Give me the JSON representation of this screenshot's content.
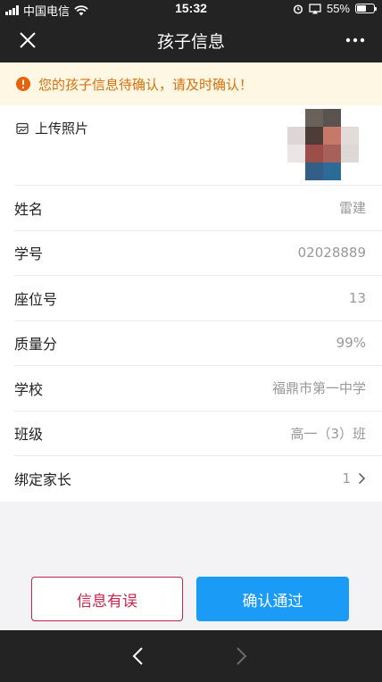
{
  "status_bar": {
    "carrier": "中国电信",
    "time": "15:32",
    "battery": "55%",
    "battery_level": 0.55
  },
  "nav": {
    "title": "孩子信息",
    "close_icon": "close-icon",
    "more_icon": "more-icon"
  },
  "notice": {
    "text": "您的孩子信息待确认，请及时确认！",
    "icon": "warning-icon",
    "color": "#d8710e"
  },
  "photo": {
    "upload_label": "上传照片",
    "icon": "image-icon"
  },
  "fields": [
    {
      "label": "姓名",
      "value": "雷建"
    },
    {
      "label": "学号",
      "value": "02028889"
    },
    {
      "label": "座位号",
      "value": "13"
    },
    {
      "label": "质量分",
      "value": "99%"
    },
    {
      "label": "学校",
      "value": "福鼎市第一中学"
    },
    {
      "label": "班级",
      "value": "高一（3）班"
    },
    {
      "label": "绑定家长",
      "value": "1"
    }
  ],
  "actions": {
    "error_label": "信息有误",
    "confirm_label": "确认通过",
    "error_color": "#c8244a",
    "confirm_color": "#1a9bf5"
  },
  "bottom_nav": {
    "back_icon": "chevron-left-icon",
    "forward_icon": "chevron-right-icon"
  }
}
